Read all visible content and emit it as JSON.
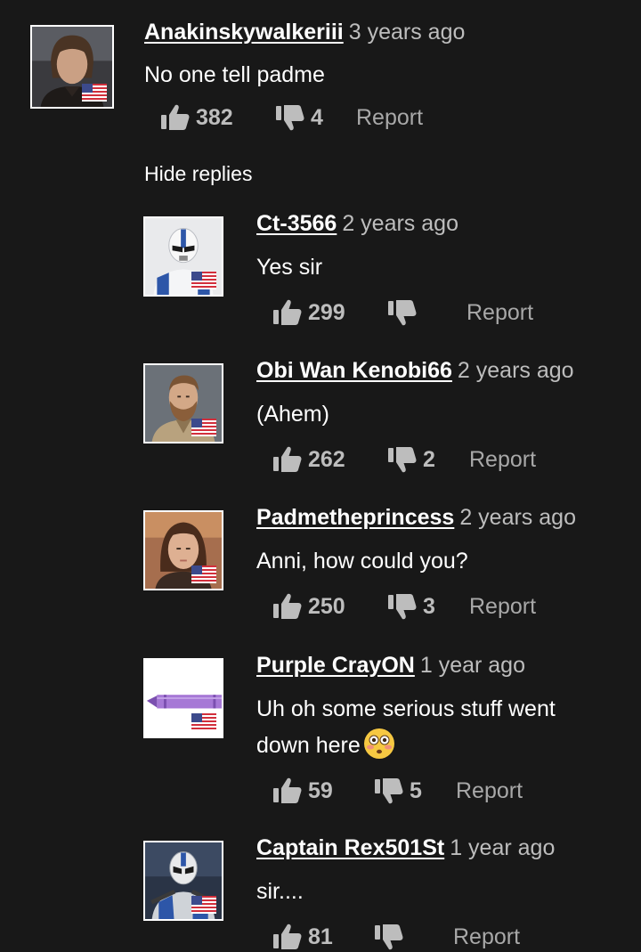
{
  "colors": {
    "background": "#181818",
    "text": "#ffffff",
    "muted": "#bdbdbd",
    "report": "#a8a8a8"
  },
  "main_comment": {
    "username": "Anakinskywalkeriii",
    "time": "3 years ago",
    "text": "No one tell padme",
    "likes": "382",
    "dislikes": "4",
    "report_label": "Report",
    "avatar": "anakin-portrait",
    "flag": "us-flag-icon"
  },
  "hide_replies_label": "Hide replies",
  "replies": [
    {
      "username": "Ct-3566",
      "time": "2 years ago",
      "text": "Yes sir",
      "likes": "299",
      "dislikes": "",
      "report_label": "Report",
      "avatar": "clone-trooper-portrait",
      "flag": "us-flag-icon"
    },
    {
      "username": "Obi Wan Kenobi66",
      "time": "2 years ago",
      "text": "(Ahem)",
      "likes": "262",
      "dislikes": "2",
      "report_label": "Report",
      "avatar": "obi-wan-portrait",
      "flag": "us-flag-icon"
    },
    {
      "username": "Padmetheprincess",
      "time": "2 years ago",
      "text": "Anni, how could you?",
      "likes": "250",
      "dislikes": "3",
      "report_label": "Report",
      "avatar": "padme-portrait",
      "flag": "us-flag-icon"
    },
    {
      "username": "Purple CrayON",
      "time": "1 year ago",
      "text_line1": "Uh oh some serious stuff went",
      "text_line2": "down here",
      "emoji": "flushed-face-emoji",
      "likes": "59",
      "dislikes": "5",
      "report_label": "Report",
      "avatar": "purple-crayon-image",
      "flag": "us-flag-icon"
    },
    {
      "username": "Captain Rex501St",
      "time": "1 year ago",
      "text": "sir....",
      "likes": "81",
      "dislikes": "",
      "report_label": "Report",
      "avatar": "captain-rex-portrait",
      "flag": "us-flag-icon"
    }
  ]
}
